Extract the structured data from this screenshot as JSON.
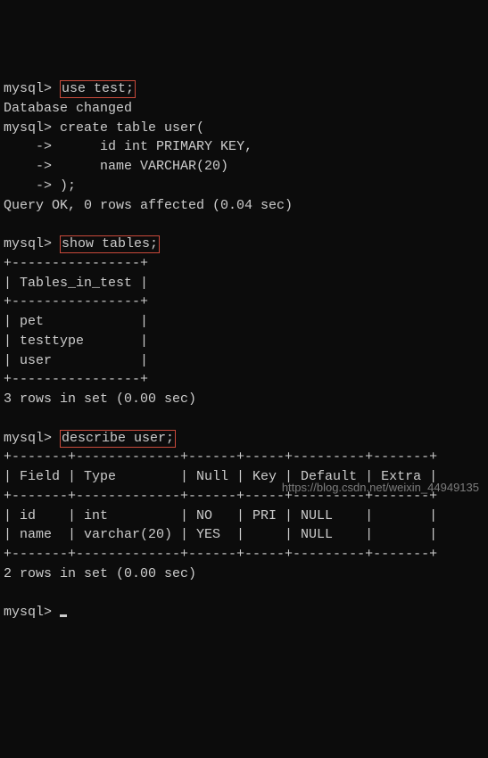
{
  "prompt": "mysql>",
  "cont": "    ->",
  "cmd1": "use test;",
  "resp1": "Database changed",
  "cmd2_l1": "create table user(",
  "cmd2_l2": "     id int PRIMARY KEY,",
  "cmd2_l3": "     name VARCHAR(20)",
  "cmd2_l4": ");",
  "resp2": "Query OK, 0 rows affected (0.04 sec)",
  "cmd3": "show tables;",
  "table1": {
    "border": "+----------------+",
    "header": "| Tables_in_test |",
    "rows": [
      "| pet            |",
      "| testtype       |",
      "| user           |"
    ]
  },
  "resp3": "3 rows in set (0.00 sec)",
  "cmd4": "describe user;",
  "table2": {
    "border": "+-------+-------------+------+-----+---------+-------+",
    "header": "| Field | Type        | Null | Key | Default | Extra |",
    "rows": [
      "| id    | int         | NO   | PRI | NULL    |       |",
      "| name  | varchar(20) | YES  |     | NULL    |       |"
    ]
  },
  "resp4": "2 rows in set (0.00 sec)",
  "watermark": "https://blog.csdn.net/weixin_44949135"
}
